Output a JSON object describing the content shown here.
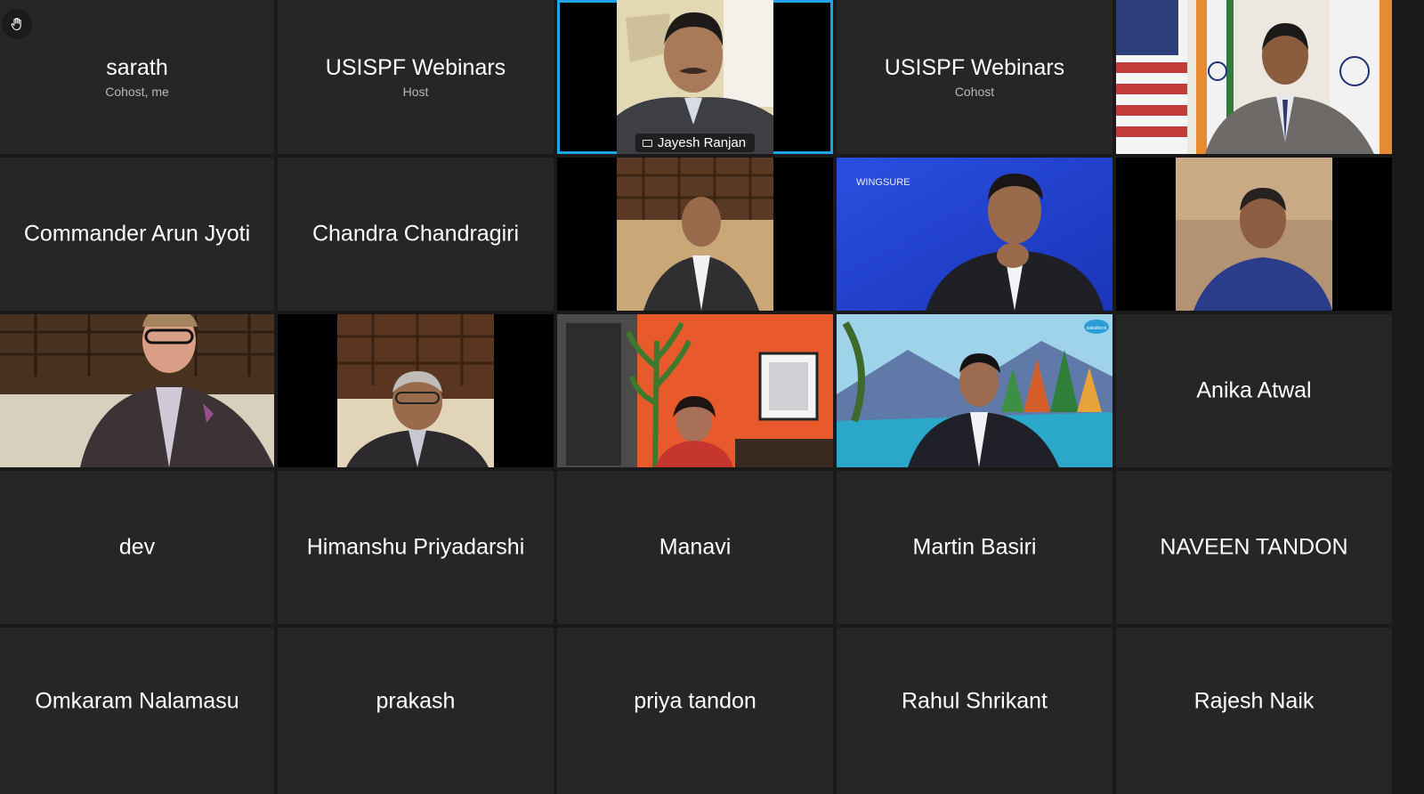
{
  "toolbar": {
    "raise_hand_icon": "raise-hand-icon"
  },
  "colors": {
    "tile_background": "#262626",
    "gallery_background": "#1a1a1a",
    "active_speaker_border": "#1fa4e8"
  },
  "participants": {
    "sarath": {
      "name": "sarath",
      "role": "Cohost, me"
    },
    "usispf_host": {
      "name": "USISPF Webinars",
      "role": "Host"
    },
    "jayesh": {
      "name": "Jayesh Ranjan",
      "icon": "screen-share-icon"
    },
    "usispf_cohost": {
      "name": "USISPF Webinars",
      "role": "Cohost"
    },
    "commander": {
      "name": "Commander Arun Jyoti"
    },
    "chandra": {
      "name": "Chandra Chandragiri"
    },
    "anika": {
      "name": "Anika Atwal"
    },
    "dev": {
      "name": "dev"
    },
    "himanshu": {
      "name": "Himanshu Priyadarshi"
    },
    "manavi": {
      "name": "Manavi"
    },
    "martin": {
      "name": "Martin Basiri"
    },
    "naveen": {
      "name": "NAVEEN TANDON"
    },
    "omkaram": {
      "name": "Omkaram Nalamasu"
    },
    "prakash": {
      "name": "prakash"
    },
    "priya": {
      "name": "priya tandon"
    },
    "rahul": {
      "name": "Rahul Shrikant"
    },
    "rajesh": {
      "name": "Rajesh Naik"
    }
  },
  "video_backgrounds": {
    "wingsure_logo_text": "WINGSURE",
    "cloud_badge_text": "salesforce"
  }
}
